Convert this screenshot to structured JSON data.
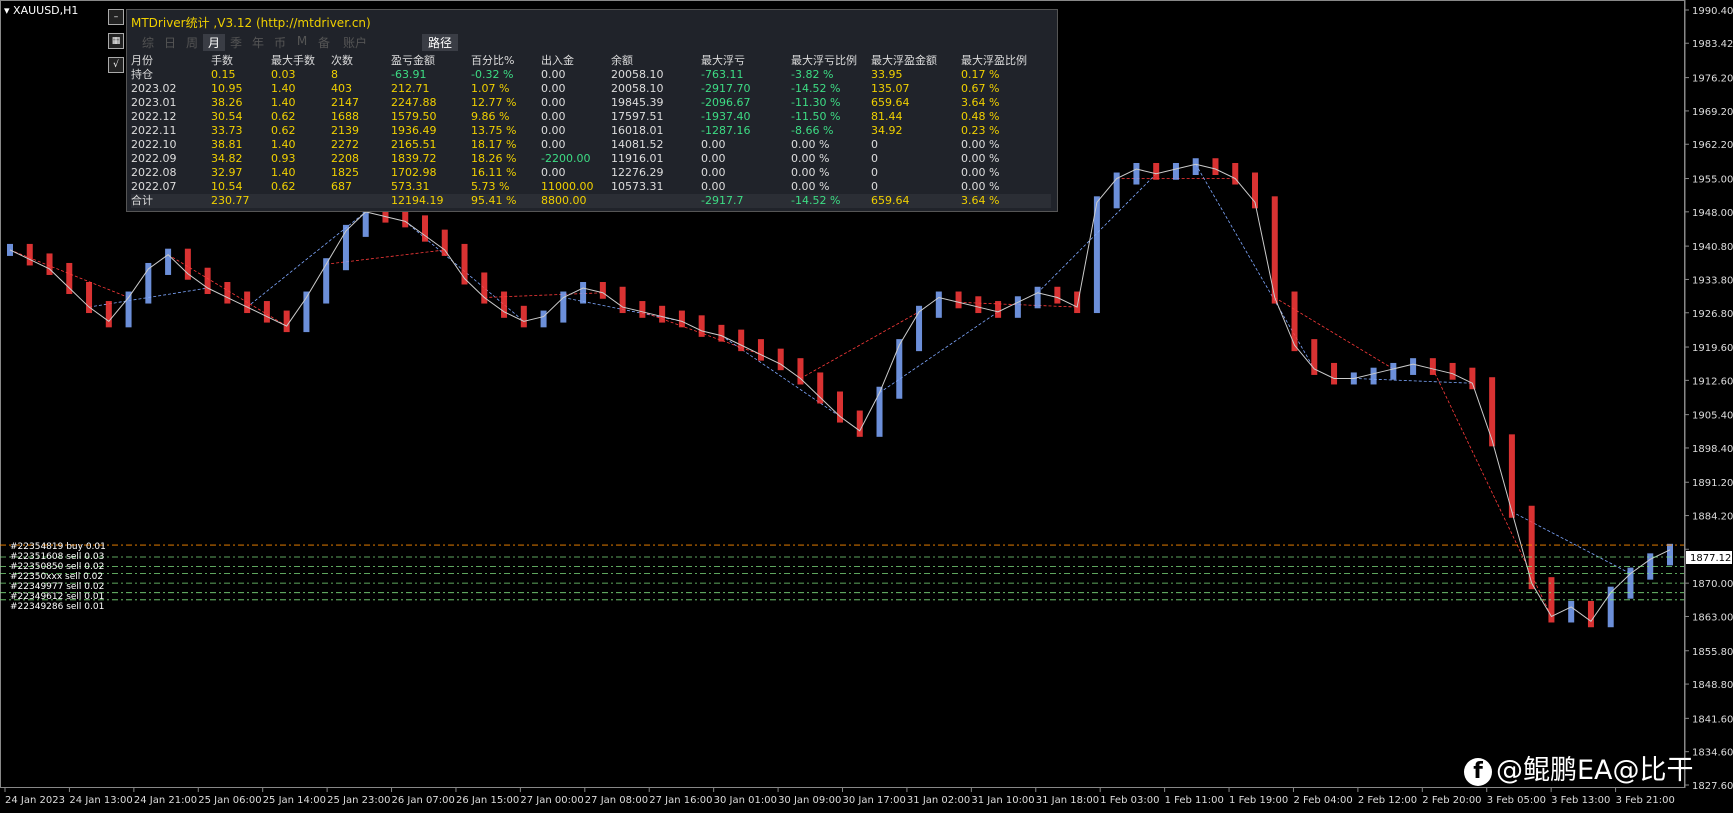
{
  "symbol": "XAUUSD,H1",
  "panel": {
    "title": "MTDriver统计 ,V3.12 (http://mtdriver.cn)",
    "tabs": [
      "综",
      "日",
      "周",
      "月",
      "季",
      "年",
      "币",
      "M",
      "备",
      "账户"
    ],
    "active_tab": 3,
    "path_button": "路径",
    "columns": [
      "月份",
      "手数",
      "最大手数",
      "次数",
      "盈亏金额",
      "百分比%",
      "出入金",
      "余额",
      "最大浮亏",
      "最大浮亏比例",
      "最大浮盈金额",
      "最大浮盈比例"
    ],
    "rows": [
      [
        "持仓",
        "0.15",
        "0.03",
        "8",
        "-63.91",
        "-0.32 %",
        "0.00",
        "20058.10",
        "-763.11",
        "-3.82 %",
        "33.95",
        "0.17 %"
      ],
      [
        "2023.02",
        "10.95",
        "1.40",
        "403",
        "212.71",
        "1.07 %",
        "0.00",
        "20058.10",
        "-2917.70",
        "-14.52 %",
        "135.07",
        "0.67 %"
      ],
      [
        "2023.01",
        "38.26",
        "1.40",
        "2147",
        "2247.88",
        "12.77 %",
        "0.00",
        "19845.39",
        "-2096.67",
        "-11.30 %",
        "659.64",
        "3.64 %"
      ],
      [
        "2022.12",
        "30.54",
        "0.62",
        "1688",
        "1579.50",
        "9.86 %",
        "0.00",
        "17597.51",
        "-1937.40",
        "-11.50 %",
        "81.44",
        "0.48 %"
      ],
      [
        "2022.11",
        "33.73",
        "0.62",
        "2139",
        "1936.49",
        "13.75 %",
        "0.00",
        "16018.01",
        "-1287.16",
        "-8.66 %",
        "34.92",
        "0.23 %"
      ],
      [
        "2022.10",
        "38.81",
        "1.40",
        "2272",
        "2165.51",
        "18.17 %",
        "0.00",
        "14081.52",
        "0.00",
        "0.00 %",
        "0",
        "0.00 %"
      ],
      [
        "2022.09",
        "34.82",
        "0.93",
        "2208",
        "1839.72",
        "18.26 %",
        "-2200.00",
        "11916.01",
        "0.00",
        "0.00 %",
        "0",
        "0.00 %"
      ],
      [
        "2022.08",
        "32.97",
        "1.40",
        "1825",
        "1702.98",
        "16.11 %",
        "0.00",
        "12276.29",
        "0.00",
        "0.00 %",
        "0",
        "0.00 %"
      ],
      [
        "2022.07",
        "10.54",
        "0.62",
        "687",
        "573.31",
        "5.73 %",
        "11000.00",
        "10573.31",
        "0.00",
        "0.00 %",
        "0",
        "0.00 %"
      ]
    ],
    "total": [
      "合计",
      "230.77",
      "",
      "",
      "12194.19",
      "95.41 %",
      "8800.00",
      "",
      "-2917.7",
      "-14.52 %",
      "659.64",
      "3.64 %"
    ]
  },
  "colors": {
    "header": "#dddddd",
    "month": "#dddddd",
    "value": "#f0d000",
    "negative": "#3ddc84",
    "zero": "#dddddd",
    "bull": "#7fa8ff",
    "bear": "#ff3b3b",
    "up_candle": "#00ff66"
  },
  "order_labels": [
    "#22354819 buy 0.01",
    "#22351608 sell 0.03",
    "#22350850 sell 0.02",
    "#22350xxx sell 0.02",
    "#22349977 sell 0.02",
    "#22349612 sell 0.01",
    "#22349286 sell 0.01"
  ],
  "current_price": "1877.12",
  "watermark": "@鲲鹏EA@比干",
  "chart_data": {
    "type": "line",
    "title": "",
    "y_ticks": [
      "1990.40",
      "1983.42",
      "1976.20",
      "1969.20",
      "1962.20",
      "1955.00",
      "1948.00",
      "1940.80",
      "1933.80",
      "1926.80",
      "1919.60",
      "1912.60",
      "1905.40",
      "1898.40",
      "1891.20",
      "1884.20",
      "1877.12",
      "1870.00",
      "1863.00",
      "1855.80",
      "1848.80",
      "1841.60",
      "1834.60",
      "1827.60"
    ],
    "x_ticks": [
      "24 Jan 2023",
      "24 Jan 13:00",
      "24 Jan 21:00",
      "25 Jan 06:00",
      "25 Jan 14:00",
      "25 Jan 23:00",
      "26 Jan 07:00",
      "26 Jan 15:00",
      "27 Jan 00:00",
      "27 Jan 08:00",
      "27 Jan 16:00",
      "30 Jan 01:00",
      "30 Jan 09:00",
      "30 Jan 17:00",
      "31 Jan 02:00",
      "31 Jan 10:00",
      "31 Jan 18:00",
      "1 Feb 03:00",
      "1 Feb 11:00",
      "1 Feb 19:00",
      "2 Feb 04:00",
      "2 Feb 12:00",
      "2 Feb 20:00",
      "3 Feb 05:00",
      "3 Feb 13:00",
      "3 Feb 21:00"
    ],
    "ylim": [
      1827.6,
      1990.4
    ],
    "series": [
      {
        "values": [
          1940,
          1938,
          1936,
          1932,
          1928,
          1925,
          1930,
          1936,
          1939,
          1935,
          1932,
          1930,
          1928,
          1926,
          1924,
          1930,
          1937,
          1944,
          1948,
          1947,
          1946,
          1943,
          1940,
          1934,
          1930,
          1927,
          1925,
          1926,
          1930,
          1932,
          1931,
          1928,
          1927,
          1926,
          1925,
          1923,
          1922,
          1920,
          1918,
          1916,
          1913,
          1909,
          1905,
          1902,
          1910,
          1920,
          1927,
          1930,
          1929,
          1928,
          1927,
          1929,
          1931,
          1930,
          1928,
          1950,
          1955,
          1957,
          1956,
          1957,
          1958,
          1957,
          1955,
          1950,
          1930,
          1920,
          1915,
          1913,
          1913,
          1914,
          1915,
          1916,
          1915,
          1914,
          1912,
          1900,
          1885,
          1870,
          1863,
          1865,
          1862,
          1868,
          1872,
          1875,
          1877
        ]
      }
    ]
  }
}
